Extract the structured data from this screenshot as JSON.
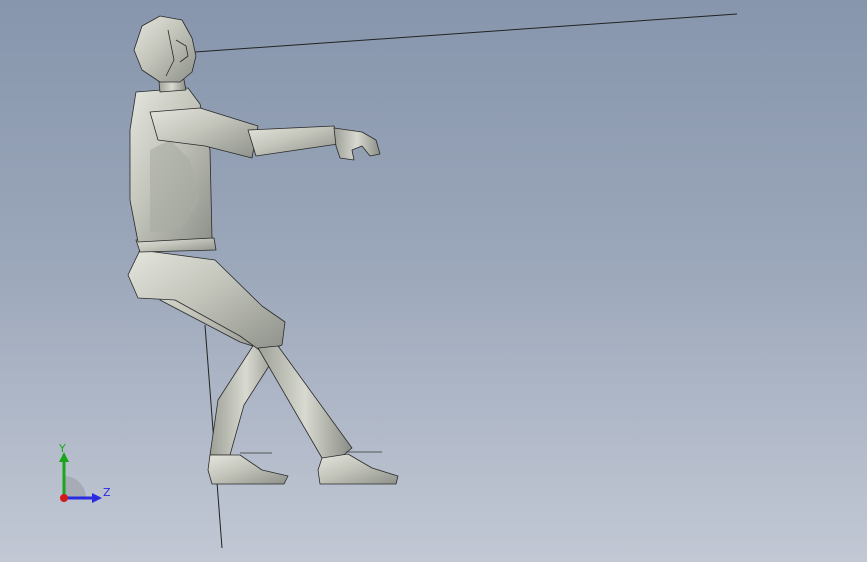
{
  "viewport": {
    "background_top": "#8796ad",
    "background_bottom": "#c2c8d4",
    "model": "seated-mannequin-side-view",
    "model_color": "#c9cbc2"
  },
  "triad": {
    "y_label": "Y",
    "z_label": "Z",
    "y_color": "#1aa51a",
    "z_color": "#2a2ae0",
    "x_color": "#d11a1a",
    "icon": "coordinate-triad-icon"
  }
}
